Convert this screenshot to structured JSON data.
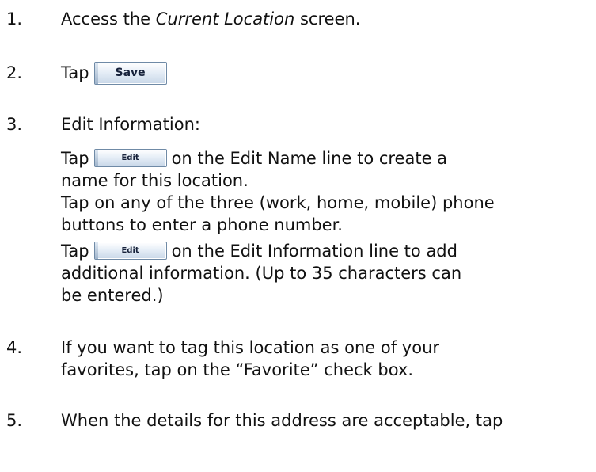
{
  "steps": [
    {
      "num": "1.",
      "text_before": "Access the ",
      "text_italic": "Current Location",
      "text_after": " screen."
    },
    {
      "num": "2.",
      "text": "Tap",
      "button": "Save"
    },
    {
      "num": "3.",
      "text": "Edit Information:",
      "sub1_before": "Tap",
      "sub1_button": "Edit",
      "sub1_line1": "on the Edit Name line to create a",
      "sub1_line2": "name for this location.",
      "sub2_line1": "Tap on any of the three (work, home, mobile) phone",
      "sub2_line2": "buttons to enter a phone number.",
      "sub3_before": "Tap",
      "sub3_button": "Edit",
      "sub3_line1": "on the Edit Information line to add",
      "sub3_line2": "additional information.  (Up to 35 characters can",
      "sub3_line3": "be entered.)"
    },
    {
      "num": "4.",
      "line1": "If you want to tag this location as one of your",
      "line2": "favorites, tap on the “Favorite” check box."
    },
    {
      "num": "5.",
      "line1": "When the details for this address are acceptable, tap"
    }
  ]
}
